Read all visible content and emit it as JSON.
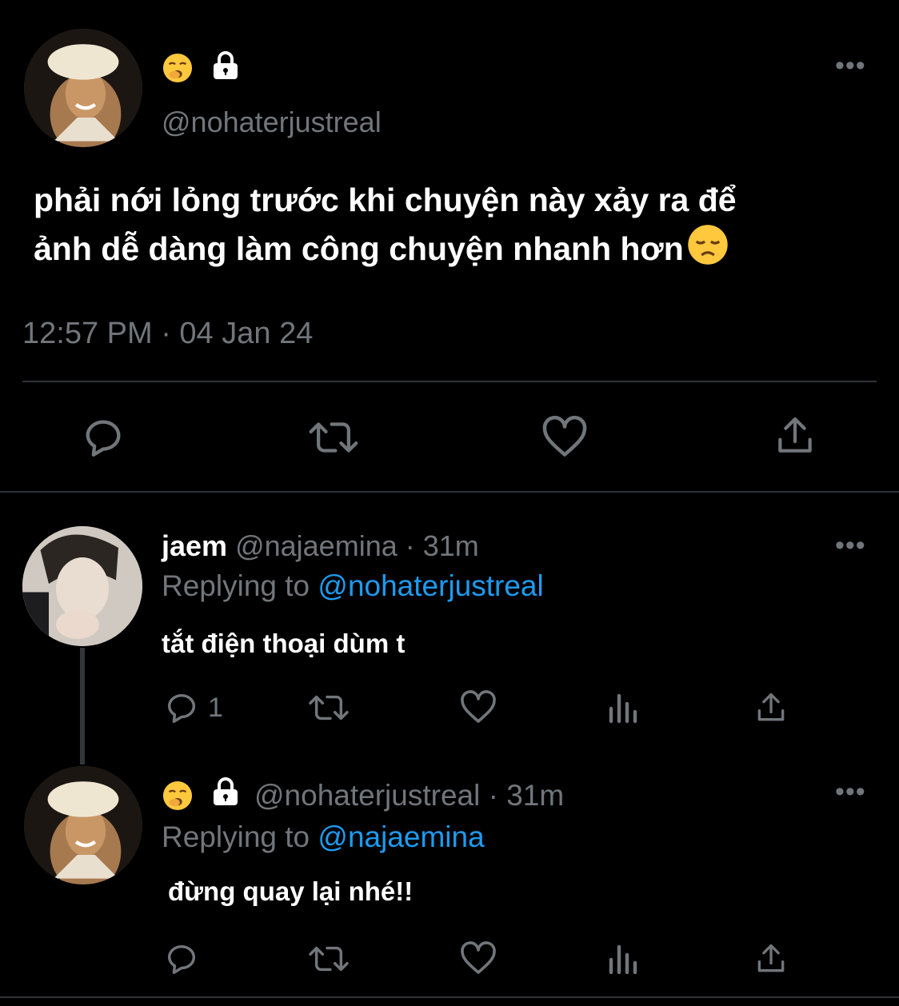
{
  "main_tweet": {
    "handle": "@nohaterjustreal",
    "text_line1": "phải nới lỏng trước khi chuyện này xảy ra để",
    "text_line2": "ảnh dễ dàng làm công chuyện nhanh hơn",
    "timestamp": "12:57 PM · 04 Jan 24",
    "badges": [
      "yawning-face-emoji",
      "lock-icon"
    ],
    "trailing_emoji": "disappointed-face-emoji"
  },
  "replies": [
    {
      "display_name": "jaem",
      "handle_time": "@najaemina · 31m",
      "replying_prefix": "Replying to",
      "replying_to": "@nohaterjustreal",
      "text": "tắt điện thoại dùm t",
      "reply_count": "1"
    },
    {
      "handle_time": "@nohaterjustreal · 31m",
      "replying_prefix": "Replying to",
      "replying_to": "@najaemina",
      "text": "đừng quay lại nhé!!",
      "reply_count": ""
    }
  ],
  "more_label": "•••",
  "colors": {
    "background": "#000000",
    "text": "#e7e9ea",
    "muted": "#71767b",
    "link": "#1d9bf0",
    "divider": "#2f3336"
  }
}
